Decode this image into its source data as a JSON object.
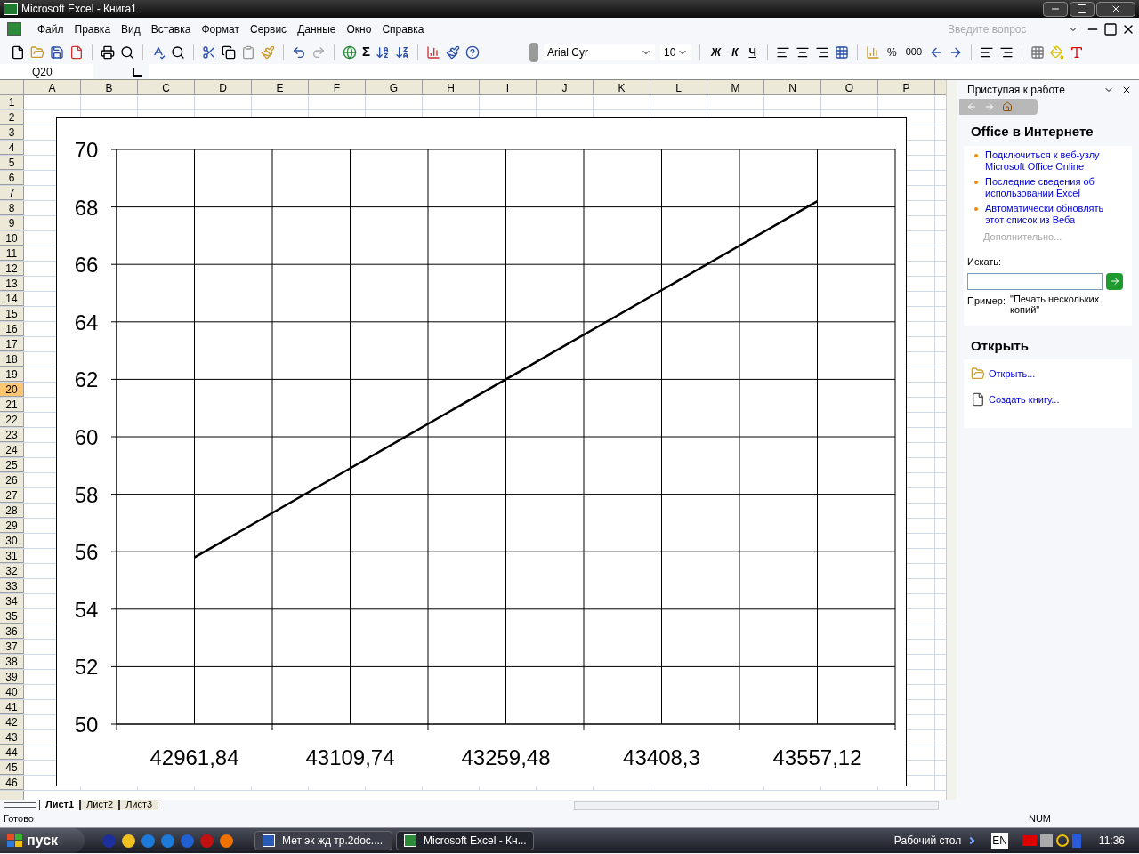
{
  "window": {
    "title": "Microsoft Excel - Книга1"
  },
  "menu": [
    "Файл",
    "Правка",
    "Вид",
    "Вставка",
    "Формат",
    "Сервис",
    "Данные",
    "Окно",
    "Справка"
  ],
  "help_field": {
    "placeholder": "Введите вопрос"
  },
  "toolbar": {
    "sum": "Σ",
    "font": "Arial Cyr",
    "size": "10",
    "bold": "Ж",
    "italic": "К",
    "underline": "Ч",
    "percent": "%",
    "thousands": "000"
  },
  "name_box": "Q20",
  "columns": [
    {
      "label": "A",
      "selected": false
    },
    {
      "label": "B",
      "selected": false
    },
    {
      "label": "C",
      "selected": false
    },
    {
      "label": "D",
      "selected": false
    },
    {
      "label": "E",
      "selected": false
    },
    {
      "label": "F",
      "selected": false
    },
    {
      "label": "G",
      "selected": false
    },
    {
      "label": "H",
      "selected": false
    },
    {
      "label": "I",
      "selected": false
    },
    {
      "label": "J",
      "selected": false
    },
    {
      "label": "K",
      "selected": false
    },
    {
      "label": "L",
      "selected": false
    },
    {
      "label": "M",
      "selected": false
    },
    {
      "label": "N",
      "selected": false
    },
    {
      "label": "O",
      "selected": false
    },
    {
      "label": "P",
      "selected": false
    }
  ],
  "rows": [
    {
      "label": "1",
      "selected": false
    },
    {
      "label": "2",
      "selected": false
    },
    {
      "label": "3",
      "selected": false
    },
    {
      "label": "4",
      "selected": false
    },
    {
      "label": "5",
      "selected": false
    },
    {
      "label": "6",
      "selected": false
    },
    {
      "label": "7",
      "selected": false
    },
    {
      "label": "8",
      "selected": false
    },
    {
      "label": "9",
      "selected": false
    },
    {
      "label": "10",
      "selected": false
    },
    {
      "label": "11",
      "selected": false
    },
    {
      "label": "12",
      "selected": false
    },
    {
      "label": "13",
      "selected": false
    },
    {
      "label": "14",
      "selected": false
    },
    {
      "label": "15",
      "selected": false
    },
    {
      "label": "16",
      "selected": false
    },
    {
      "label": "17",
      "selected": false
    },
    {
      "label": "18",
      "selected": false
    },
    {
      "label": "19",
      "selected": false
    },
    {
      "label": "20",
      "selected": true
    },
    {
      "label": "21",
      "selected": false
    },
    {
      "label": "22",
      "selected": false
    },
    {
      "label": "23",
      "selected": false
    },
    {
      "label": "24",
      "selected": false
    },
    {
      "label": "25",
      "selected": false
    },
    {
      "label": "26",
      "selected": false
    },
    {
      "label": "27",
      "selected": false
    },
    {
      "label": "28",
      "selected": false
    },
    {
      "label": "29",
      "selected": false
    },
    {
      "label": "30",
      "selected": false
    },
    {
      "label": "31",
      "selected": false
    },
    {
      "label": "32",
      "selected": false
    },
    {
      "label": "33",
      "selected": false
    },
    {
      "label": "34",
      "selected": false
    },
    {
      "label": "35",
      "selected": false
    },
    {
      "label": "36",
      "selected": false
    },
    {
      "label": "37",
      "selected": false
    },
    {
      "label": "38",
      "selected": false
    },
    {
      "label": "39",
      "selected": false
    },
    {
      "label": "40",
      "selected": false
    },
    {
      "label": "41",
      "selected": false
    },
    {
      "label": "42",
      "selected": false
    },
    {
      "label": "43",
      "selected": false
    },
    {
      "label": "44",
      "selected": false
    },
    {
      "label": "45",
      "selected": false
    },
    {
      "label": "46",
      "selected": false
    }
  ],
  "chart": {
    "chart_data": {
      "type": "line",
      "categories": [
        "42961,84",
        "43109,74",
        "43259,48",
        "43408,3",
        "43557,12"
      ],
      "series": [
        {
          "color": "#000000",
          "values": [
            55.8,
            58.9,
            62.0,
            65.1,
            68.2
          ]
        }
      ],
      "grid": true,
      "ylim": [
        50,
        70
      ],
      "yticks": [
        50,
        52,
        54,
        56,
        58,
        60,
        62,
        64,
        66,
        68,
        70
      ]
    }
  },
  "sheet_tabs": [
    {
      "label": "Лист1",
      "selected": true
    },
    {
      "label": "Лист2",
      "selected": false
    },
    {
      "label": "Лист3",
      "selected": false
    }
  ],
  "status_bar": {
    "text": "Готово",
    "num": "NUM"
  },
  "task_pane": {
    "title": "Приступая к работе",
    "online": {
      "heading": "Office в Интернете",
      "links": [
        "Подключиться к веб-узлу Microsoft Office Online",
        "Последние сведения об использовании Excel",
        "Автоматически обновлять этот список из Веба"
      ],
      "more": "Дополнительно...",
      "search_label": "Искать:",
      "example_label": "Пример:",
      "example": "\"Печать нескольких копий\""
    },
    "open": {
      "heading": "Открыть",
      "links": [
        {
          "kind": "folder",
          "label": "Открыть..."
        },
        {
          "kind": "file",
          "label": "Создать книгу..."
        }
      ]
    }
  },
  "taskbar": {
    "start": "пуск",
    "tasks": [
      {
        "kind": "word",
        "label": "Мет эк жд тр.2doc....",
        "selected": false
      },
      {
        "kind": "excel",
        "label": "Microsoft Excel - Кн...",
        "selected": true
      }
    ],
    "desktop": "Рабочий стол",
    "lang": "EN",
    "clock": "11:36"
  }
}
